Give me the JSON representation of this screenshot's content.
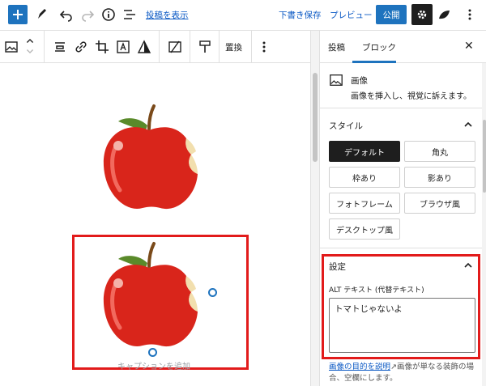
{
  "topbar": {
    "view_post_link": "投稿を表示",
    "save_draft": "下書き保存",
    "preview": "プレビュー",
    "publish": "公開"
  },
  "block_toolbar": {
    "replace_label": "置換"
  },
  "canvas": {
    "caption_placeholder": "キャプションを追加"
  },
  "sidebar": {
    "tabs": [
      "投稿",
      "ブロック"
    ],
    "active_tab": "ブロック",
    "block": {
      "title": "画像",
      "description": "画像を挿入し、視覚に訴えます。"
    },
    "styles_section": {
      "title": "スタイル",
      "options": [
        "デフォルト",
        "角丸",
        "枠あり",
        "影あり",
        "フォトフレーム",
        "ブラウザ風",
        "デスクトップ風"
      ],
      "selected": "デフォルト"
    },
    "settings_section": {
      "title": "設定",
      "alt_label": "ALT テキスト (代替テキスト)",
      "alt_value": "トマトじゃないよ",
      "help_link": "画像の目的を説明",
      "help_text": "画像が単なる装飾の場合、空欄にします。"
    }
  },
  "colors": {
    "accent": "#1e73be",
    "highlight": "#e21b1b",
    "dark": "#1e1e1e"
  }
}
